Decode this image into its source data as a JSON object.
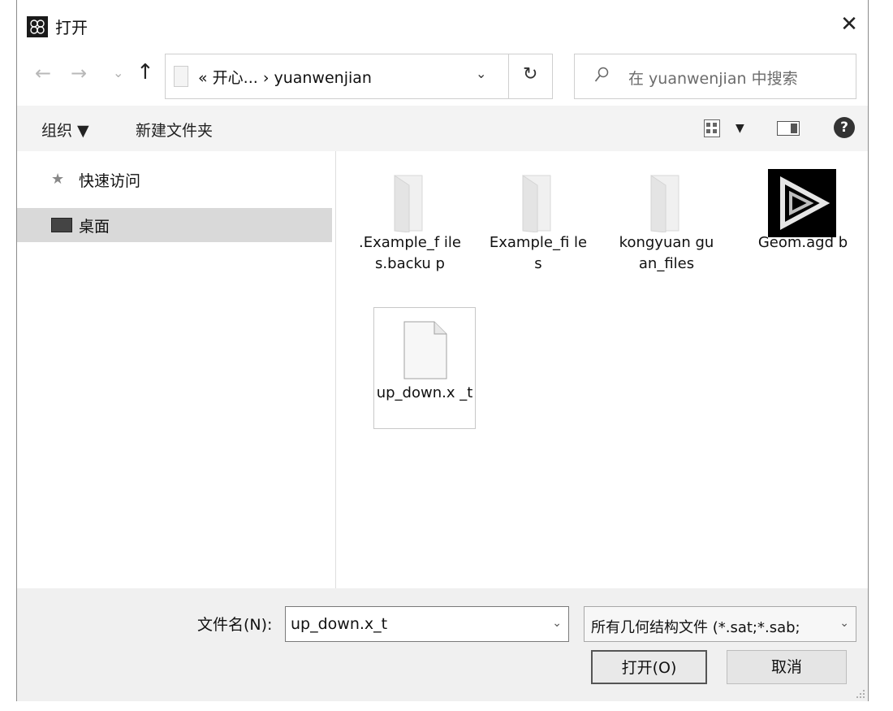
{
  "window": {
    "title": "打开",
    "close_glyph": "✕"
  },
  "nav": {
    "back_glyph": "←",
    "forward_glyph": "→",
    "recent_glyph": "⌄",
    "up_glyph": "↑",
    "breadcrumb_text": "«  开心...  ›  yuanwenjian",
    "dropdown_glyph": "⌄",
    "refresh_glyph": "↻",
    "search_placeholder": "在 yuanwenjian 中搜索"
  },
  "toolbar": {
    "organize_label": "组织 ▼",
    "new_folder_label": "新建文件夹",
    "view_dropdown_glyph": "▼",
    "help_glyph": "?"
  },
  "sidebar": {
    "items": [
      {
        "label": "快速访问",
        "icon": "star-icon"
      },
      {
        "label": "桌面",
        "icon": "desktop-icon"
      }
    ]
  },
  "files": [
    {
      "name": ".Example_f iles.backu p",
      "type": "folder"
    },
    {
      "name": "Example_fi les",
      "type": "folder"
    },
    {
      "name": "kongyuan guan_files",
      "type": "folder"
    },
    {
      "name": "Geom.agd b",
      "type": "geom-file"
    },
    {
      "name": "up_down.x _t",
      "type": "document",
      "selected": true
    }
  ],
  "bottom": {
    "filename_label": "文件名(N):",
    "filename_value": "up_down.x_t",
    "filename_dropdown_glyph": "⌄",
    "filter_value": "所有几何结构文件 (*.sat;*.sab;",
    "filter_dropdown_glyph": "⌄",
    "open_label": "打开(O)",
    "cancel_label": "取消"
  },
  "colors": {
    "selection": "#d9d9d9",
    "toolbar_bg": "#f3f3f3",
    "bottom_bg": "#f0f0f0"
  }
}
